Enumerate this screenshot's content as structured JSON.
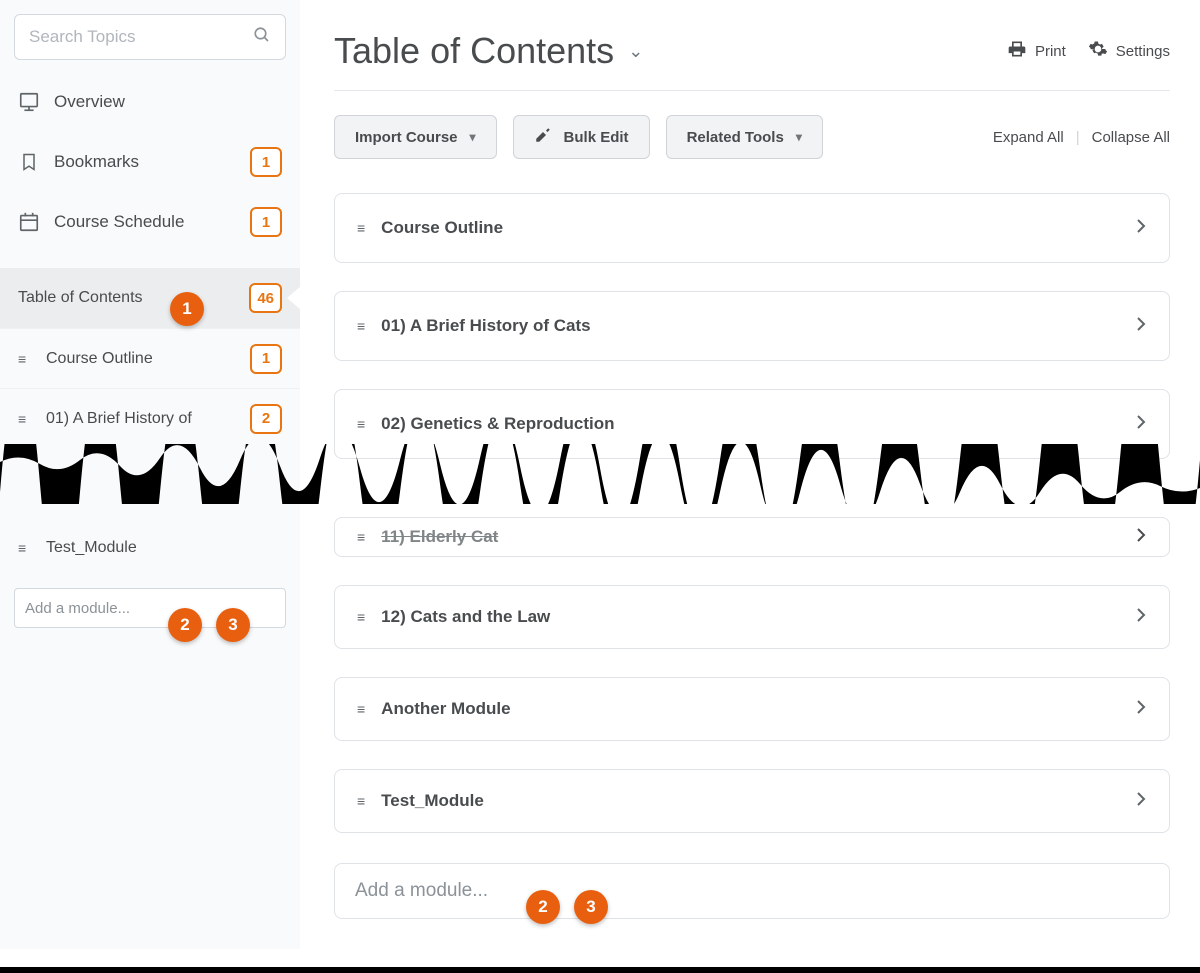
{
  "sidebar": {
    "search_placeholder": "Search Topics",
    "overview": "Overview",
    "bookmarks": "Bookmarks",
    "bookmarks_count": "1",
    "schedule": "Course Schedule",
    "schedule_count": "1",
    "toc": "Table of Contents",
    "toc_count": "46",
    "sub": [
      {
        "label": "Course Outline",
        "count": "1"
      },
      {
        "label": "01) A Brief History of",
        "count": "2"
      },
      {
        "label": "Test_Module",
        "count": ""
      }
    ],
    "add_module_placeholder": "Add a module..."
  },
  "header": {
    "title": "Table of Contents",
    "print": "Print",
    "settings": "Settings"
  },
  "toolbar": {
    "import": "Import Course",
    "bulk_edit": "Bulk Edit",
    "related": "Related Tools",
    "expand": "Expand All",
    "collapse": "Collapse All"
  },
  "modules": {
    "top": [
      {
        "title": "Course Outline"
      },
      {
        "title": "01) A Brief History of Cats"
      },
      {
        "title": "02) Genetics & Reproduction"
      }
    ],
    "peek": "11) Elderly Cat",
    "bottom": [
      {
        "title": "12) Cats and the Law"
      },
      {
        "title": "Another Module"
      },
      {
        "title": "Test_Module"
      }
    ],
    "add_module_placeholder": "Add a module..."
  },
  "annotations": {
    "toc": "1",
    "side2": "2",
    "side3": "3",
    "main2": "2",
    "main3": "3"
  }
}
